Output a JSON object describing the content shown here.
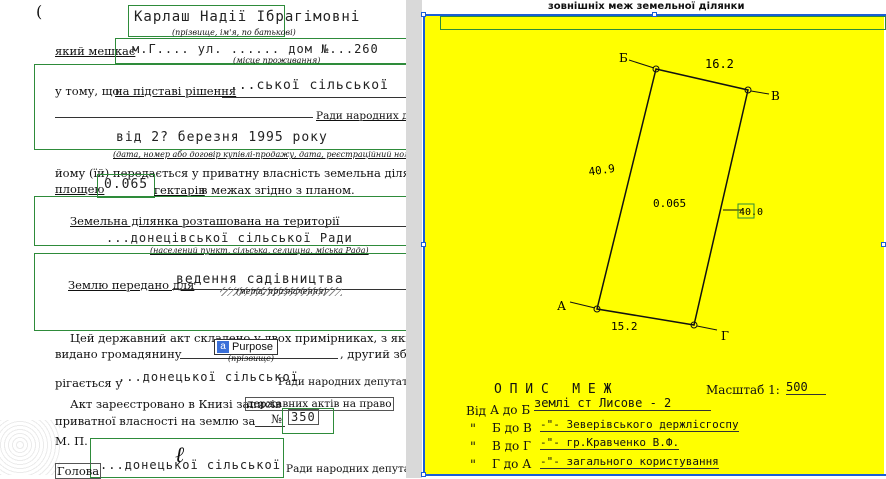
{
  "left_page": {
    "name_hand": "Карлаш Надії Ібрагімовні",
    "name_caption": "(прізвище, ім'я, по батькові)",
    "residence_label": "який мешкає",
    "residence_hand": "м.Г....   ул. ...... дом №...260",
    "residence_caption": "(місце проживання)",
    "basis_label": "у тому, що",
    "basis_underlined": "на підставі рішення",
    "basis_hand": "...ської сільської",
    "council_label": "Ради народних депутатів",
    "date_hand": "від 2? березня 1995 року",
    "date_caption": "(дата, номер або договір купівлі-продажу, дата, реєстраційний номер)",
    "transfer_text": "йому (їй) передається у приватну власність земельна ділянка",
    "area_label": "площею",
    "area_hand": "0.065",
    "area_unit": "гектарів",
    "plan_ref": "в межах згідно    з планом.",
    "location_label": "Земельна ділянка розташована на території",
    "location_hand": "...донецівської сільської Ради",
    "location_caption": "(населений пункт, сільська, селищна, міська Рада)",
    "purpose_label": "Землю передано для",
    "purpose_hand": "ведення садівництва",
    "purpose_caption": "(мета, призначення)",
    "copies_text": "Цей державний акт складено у двох примірниках, з яких перший",
    "issued_label": "видано громадянину",
    "surname_caption": "(прізвище)",
    "second_copy": ", другий збе-",
    "stored_label": "рігається у",
    "stored_hand": "...донецької сільської",
    "stored_suffix": "Ради народних депутатів.",
    "registered_text": "Акт зареєстровано в Книзі записів",
    "registered_underlined": "державних актів на право",
    "ownership_label": "приватної власності на землю за",
    "record_number_label": "№",
    "record_number_hand": "350",
    "seal_mark": "М. П.",
    "head_label": "Голова",
    "head_hand": "...донецької сільської",
    "head_suffix": "Ради народних депутатів"
  },
  "overlay": {
    "purpose_tag": "Purpose",
    "purpose_icon": "a"
  },
  "right_page": {
    "heading": "зовнішніх меж земельної ділянки",
    "plan": {
      "vertex_b": "Б",
      "vertex_v": "В",
      "vertex_a": "А",
      "vertex_g": "Г",
      "side_top": "16.2",
      "side_left": "40.9",
      "side_right": "40.0",
      "side_bottom": "15.2",
      "area": "0.065"
    },
    "description": {
      "title": "О П И С   М Е Ж",
      "scale_label": "Масштаб 1:",
      "scale_value": "500",
      "from_label": "Від",
      "rows": [
        {
          "route": "А до Б",
          "text": "землі ст Лисове - 2"
        },
        {
          "route": "Б до В",
          "text": "-\"- Зеверівського держлісгоспу"
        },
        {
          "route": "В до Г",
          "text": "-\"- гр.Кравченко В.Ф."
        },
        {
          "route": "Г до А",
          "text": "-\"- загального користування"
        }
      ],
      "ditto": "\""
    }
  }
}
